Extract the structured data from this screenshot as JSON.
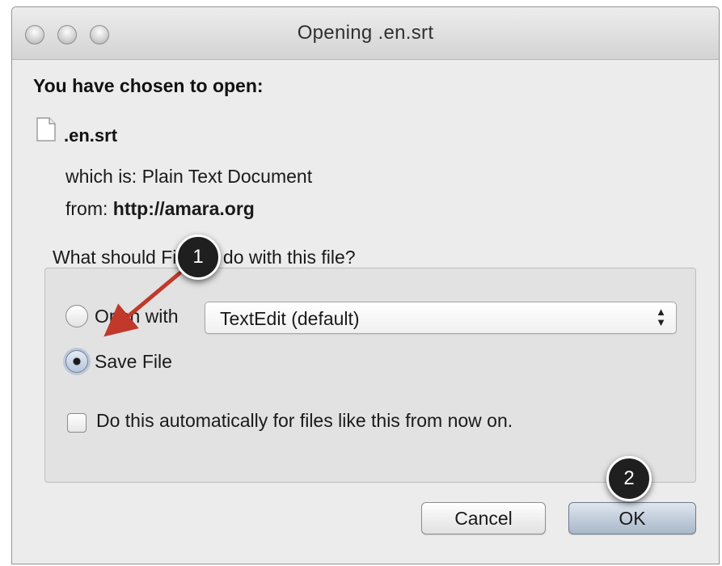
{
  "window": {
    "title": "Opening .en.srt"
  },
  "dialog": {
    "heading": "You have chosen to open:",
    "file_name": ".en.srt",
    "which_is_label": "which is:",
    "which_is_value": "Plain Text Document",
    "from_label": "from:",
    "from_value": "http://amara.org",
    "question": "What should Firefox do with this file?",
    "options": {
      "open_with_label": "Open with",
      "open_with_app": "TextEdit (default)",
      "save_file_label": "Save File",
      "selected": "save_file"
    },
    "auto_checkbox_label": "Do this automatically for files like this from now on.",
    "cancel_label": "Cancel",
    "ok_label": "OK"
  },
  "annotations": {
    "step1": "1",
    "step2": "2"
  },
  "colors": {
    "arrow": "#c0392b",
    "callout": "#1f1f1f",
    "default_button": "#a9b7c8"
  }
}
